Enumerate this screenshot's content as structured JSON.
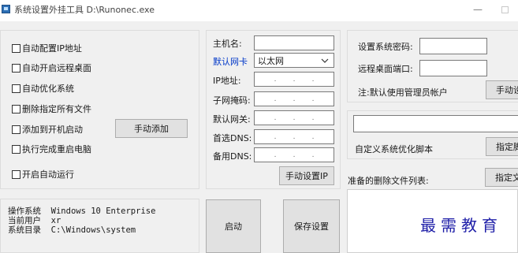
{
  "window": {
    "title": "系统设置外挂工具 D:\\Runonec.exe",
    "minimize_glyph": "—"
  },
  "options": {
    "items": [
      {
        "label": "自动配置IP地址",
        "checked": false
      },
      {
        "label": "自动开启远程桌面",
        "checked": false
      },
      {
        "label": "自动优化系统",
        "checked": false
      },
      {
        "label": "删除指定所有文件",
        "checked": false
      },
      {
        "label": "添加到开机启动",
        "checked": false
      },
      {
        "label": "执行完成重启电脑",
        "checked": false
      }
    ],
    "manual_add_button": "手动添加",
    "auto_run": {
      "label": "开启自动运行",
      "checked": false
    }
  },
  "system_info": {
    "os_label": "操作系统",
    "os_value": "Windows 10 Enterprise",
    "user_label": "当前用户",
    "user_value": "xr",
    "dir_label": "系统目录",
    "dir_value": "C:\\Windows\\system"
  },
  "network": {
    "hostname_label": "主机名:",
    "hostname_value": "",
    "nic_label": "默认网卡",
    "nic_selected": "以太网",
    "ip_label": "IP地址:",
    "subnet_label": "子网掩码:",
    "gateway_label": "默认网关:",
    "dns1_label": "首选DNS:",
    "dns2_label": "备用DNS:",
    "ip_dot": ".",
    "manual_ip_button": "手动设置IP"
  },
  "actions": {
    "start_button": "启动",
    "save_button": "保存设置"
  },
  "remote": {
    "password_label": "设置系统密码:",
    "password_value": "",
    "port_label": "远程桌面端口:",
    "port_value": "",
    "note": "注:默认使用管理员帐户",
    "manual_button": "手动设"
  },
  "optimize": {
    "script_value": "",
    "script_label": "自定义系统优化脚本",
    "select_button": "指定脚"
  },
  "delete_list": {
    "label": "准备的删除文件列表:",
    "select_button": "指定文",
    "content": ""
  },
  "watermark": "最需教育",
  "colors": {
    "blue_label": "#0037c8",
    "watermark": "#1f1fa8"
  }
}
